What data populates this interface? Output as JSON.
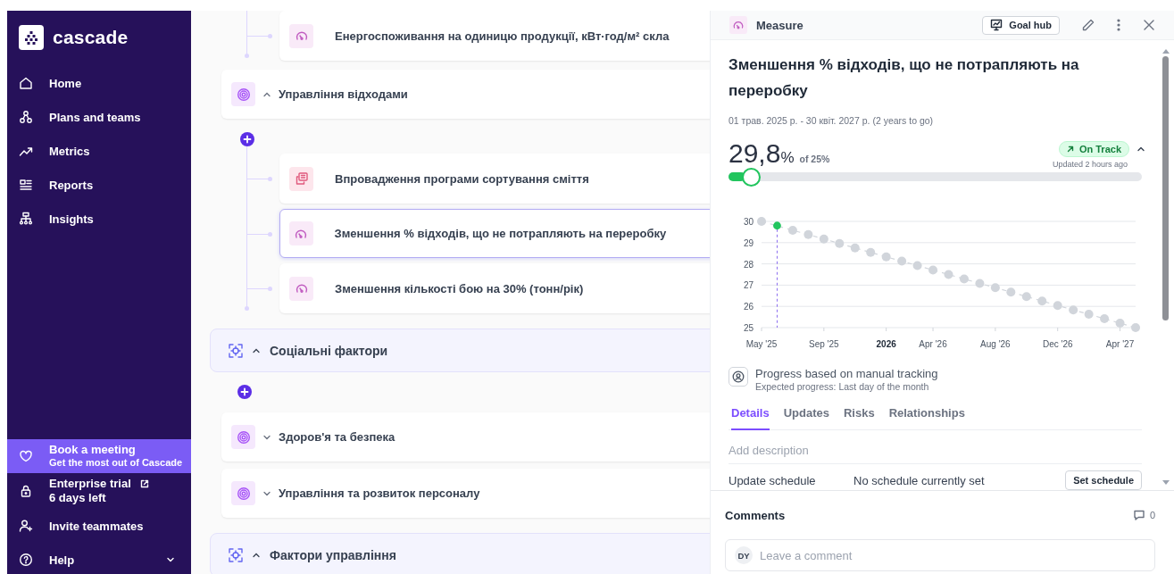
{
  "sidebar": {
    "logo": "cascade",
    "nav": [
      {
        "label": "Home",
        "selected": false
      },
      {
        "label": "Plans and teams",
        "selected": false
      },
      {
        "label": "Metrics",
        "selected": false
      },
      {
        "label": "Reports",
        "selected": false
      },
      {
        "label": "Insights",
        "selected": false
      }
    ],
    "promo": {
      "title": "Book a meeting",
      "subtitle": "Get the most out of Cascade"
    },
    "trial": {
      "title": "Enterprise trial",
      "subtitle": "6 days left"
    },
    "invite": {
      "label": "Invite teammates"
    },
    "help": {
      "label": "Help"
    }
  },
  "tree": [
    {
      "kind": "category",
      "children": [
        {
          "kind": "goal",
          "children": [
            {
              "kind": "measure",
              "label": "Енергоспоживання на одиницю продукції, кВт·год/м² скла",
              "selected": false
            }
          ]
        },
        {
          "kind": "goal",
          "label": "Управління відходами",
          "expanded": true,
          "children": [
            {
              "kind": "initiative",
              "label": "Впровадження програми сортування сміття",
              "selected": false
            },
            {
              "kind": "measure",
              "label": "Зменшення % відходів, що не потрапляють на переробку",
              "selected": true
            },
            {
              "kind": "measure",
              "label": "Зменшення кількості бою на 30% (тонн/рік)",
              "selected": false
            }
          ]
        }
      ]
    },
    {
      "kind": "category",
      "label": "Соціальні фактори",
      "expanded": true,
      "children": [
        {
          "kind": "goal",
          "label": "Здоров'я та безпека",
          "expanded": false
        },
        {
          "kind": "goal",
          "label": "Управління та розвиток персоналу",
          "expanded": false
        }
      ]
    },
    {
      "kind": "category",
      "label": "Фактори управління",
      "expanded": true
    }
  ],
  "panel": {
    "type_label": "Measure",
    "goal_hub": "Goal hub",
    "title": "Зменшення % відходів, що не потрапляють на переробку",
    "dates": "01 трав. 2025 р. - 30 квіт. 2027 р. (2 years to go)",
    "value": "29,8",
    "unit": "%",
    "target": "of 25%",
    "status": "On Track",
    "updated": "Updated 2 hours ago",
    "progress": {
      "level": 0.04
    },
    "chart_data": {
      "type": "line",
      "categories": [
        "May '25",
        null,
        null,
        null,
        "Sep '25",
        null,
        null,
        null,
        "2026",
        null,
        null,
        "Apr '26",
        null,
        null,
        null,
        "Aug '26",
        null,
        null,
        null,
        "Dec '26",
        null,
        null,
        null,
        "Apr '27",
        null
      ],
      "ylim": [
        25,
        30
      ],
      "yticks": [
        25,
        26,
        27,
        28,
        29,
        30
      ],
      "grid": true,
      "series": [
        {
          "color": "#d1d5db",
          "line_style": "dashed",
          "marker": "circle",
          "values": [
            30,
            null,
            29.58,
            29.38,
            29.17,
            28.96,
            28.75,
            28.54,
            28.33,
            28.13,
            27.92,
            27.71,
            27.5,
            27.29,
            27.08,
            26.88,
            26.67,
            26.46,
            26.25,
            26.04,
            25.83,
            25.63,
            25.42,
            25.21,
            25
          ]
        },
        {
          "color": "#22c55e",
          "marker": "circle",
          "values": [
            null,
            29.8,
            null,
            null,
            null,
            null,
            null,
            null,
            null,
            null,
            null,
            null,
            null,
            null,
            null,
            null,
            null,
            null,
            null,
            null,
            null,
            null,
            null,
            null,
            null
          ]
        }
      ]
    },
    "tracking": {
      "title": "Progress based on manual tracking",
      "subtitle": "Expected progress: Last day of the month"
    },
    "tabs": [
      {
        "label": "Details",
        "selected": true
      },
      {
        "label": "Updates",
        "selected": false
      },
      {
        "label": "Risks",
        "selected": false
      },
      {
        "label": "Relationships",
        "selected": false
      }
    ],
    "description": {
      "placeholder": "Add description"
    },
    "schedule": {
      "label": "Update schedule",
      "value": "No schedule currently set",
      "button": "Set schedule"
    }
  },
  "comments": {
    "title": "Comments",
    "count": "0",
    "avatar": "DY",
    "placeholder": "Leave a comment"
  }
}
